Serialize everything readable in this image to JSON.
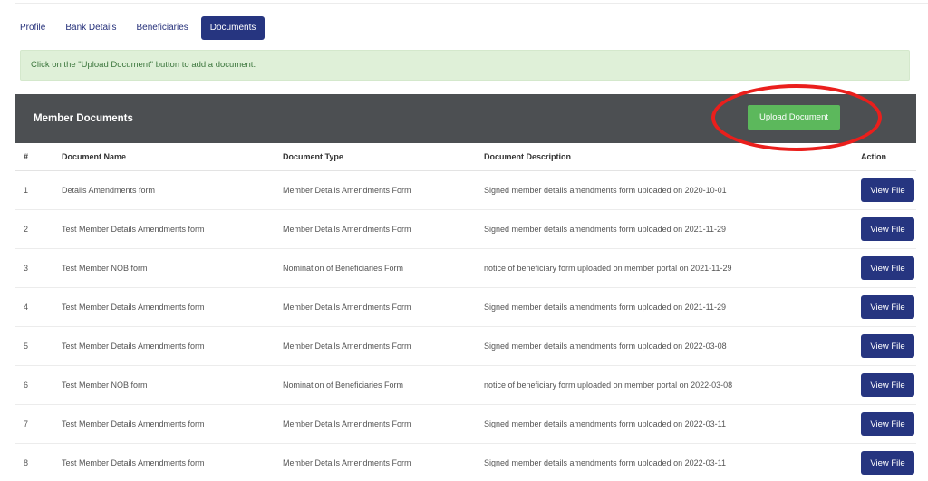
{
  "tabs": [
    {
      "label": "Profile",
      "active": false
    },
    {
      "label": "Bank Details",
      "active": false
    },
    {
      "label": "Beneficiaries",
      "active": false
    },
    {
      "label": "Documents",
      "active": true
    }
  ],
  "alert": {
    "text": "Click on the \"Upload Document\" button to add a document."
  },
  "panel": {
    "title": "Member Documents",
    "upload_label": "Upload Document"
  },
  "table": {
    "headers": {
      "num": "#",
      "name": "Document Name",
      "type": "Document Type",
      "description": "Document Description",
      "action": "Action"
    },
    "rows": [
      {
        "num": "1",
        "name": "Details Amendments form",
        "type": "Member Details Amendments Form",
        "description": "Signed member details amendments form uploaded on 2020-10-01",
        "action": "View File"
      },
      {
        "num": "2",
        "name": "Test Member Details Amendments form",
        "type": "Member Details Amendments Form",
        "description": "Signed member details amendments form uploaded on 2021-11-29",
        "action": "View File"
      },
      {
        "num": "3",
        "name": "Test Member NOB form",
        "type": "Nomination of Beneficiaries Form",
        "description": "notice of beneficiary form uploaded on member portal on 2021-11-29",
        "action": "View File"
      },
      {
        "num": "4",
        "name": "Test Member Details Amendments form",
        "type": "Member Details Amendments Form",
        "description": "Signed member details amendments form uploaded on 2021-11-29",
        "action": "View File"
      },
      {
        "num": "5",
        "name": "Test Member Details Amendments form",
        "type": "Member Details Amendments Form",
        "description": "Signed member details amendments form uploaded on 2022-03-08",
        "action": "View File"
      },
      {
        "num": "6",
        "name": "Test Member NOB form",
        "type": "Nomination of Beneficiaries Form",
        "description": "notice of beneficiary form uploaded on member portal on 2022-03-08",
        "action": "View File"
      },
      {
        "num": "7",
        "name": "Test Member Details Amendments form",
        "type": "Member Details Amendments Form",
        "description": "Signed member details amendments form uploaded on 2022-03-11",
        "action": "View File"
      },
      {
        "num": "8",
        "name": "Test Member Details Amendments form",
        "type": "Member Details Amendments Form",
        "description": "Signed member details amendments form uploaded on 2022-03-11",
        "action": "View File"
      }
    ]
  },
  "colors": {
    "primary": "#263580",
    "success": "#5cb85c",
    "panel_header": "#4c4f52",
    "alert_bg": "#dff0d8",
    "annotation": "#ea1f1c"
  }
}
